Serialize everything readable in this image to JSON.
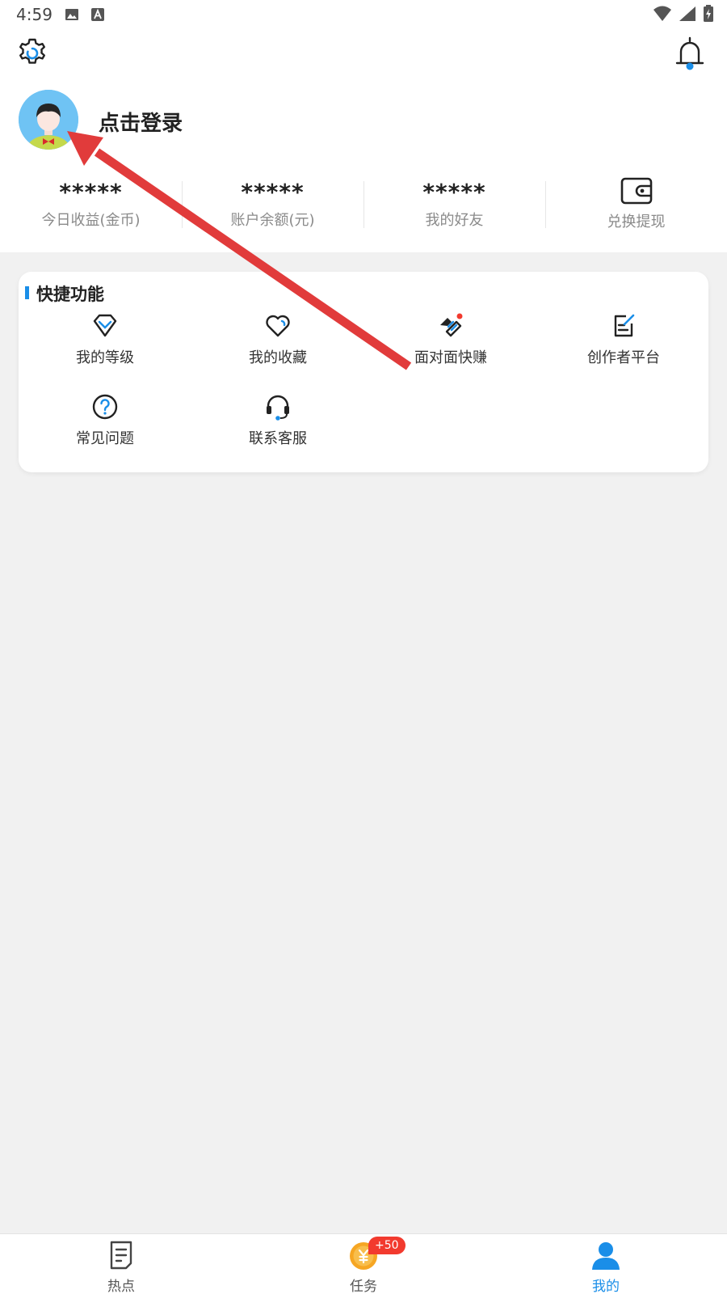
{
  "status_bar": {
    "time": "4:59",
    "left_icons": [
      "image-icon",
      "text-a-icon"
    ],
    "right_icons": [
      "wifi-icon",
      "signal-icon",
      "battery-charging-icon"
    ]
  },
  "header": {
    "settings_icon": "gear-icon",
    "notification_icon": "bell-icon",
    "login_text": "点击登录"
  },
  "stats": [
    {
      "value": "*****",
      "label": "今日收益(金币)"
    },
    {
      "value": "*****",
      "label": "账户余额(元)"
    },
    {
      "value": "*****",
      "label": "我的好友"
    },
    {
      "icon": "wallet-icon",
      "label": "兑换提现"
    }
  ],
  "quick_functions": {
    "title": "快捷功能",
    "items": [
      {
        "label": "我的等级",
        "icon": "diamond-icon"
      },
      {
        "label": "我的收藏",
        "icon": "heart-icon"
      },
      {
        "label": "面对面快赚",
        "icon": "handshake-icon"
      },
      {
        "label": "创作者平台",
        "icon": "edit-document-icon"
      },
      {
        "label": "常见问题",
        "icon": "question-circle-icon"
      },
      {
        "label": "联系客服",
        "icon": "headset-icon"
      }
    ]
  },
  "bottom_nav": {
    "items": [
      {
        "label": "热点",
        "icon": "document-icon",
        "active": false
      },
      {
        "label": "任务",
        "icon": "coin-icon",
        "active": false,
        "badge": "+50"
      },
      {
        "label": "我的",
        "icon": "user-icon",
        "active": true
      }
    ]
  },
  "colors": {
    "accent": "#1a8ee8",
    "background": "#f1f1f1",
    "badge": "#f23a2e",
    "annotation_arrow": "#e13b3b"
  }
}
